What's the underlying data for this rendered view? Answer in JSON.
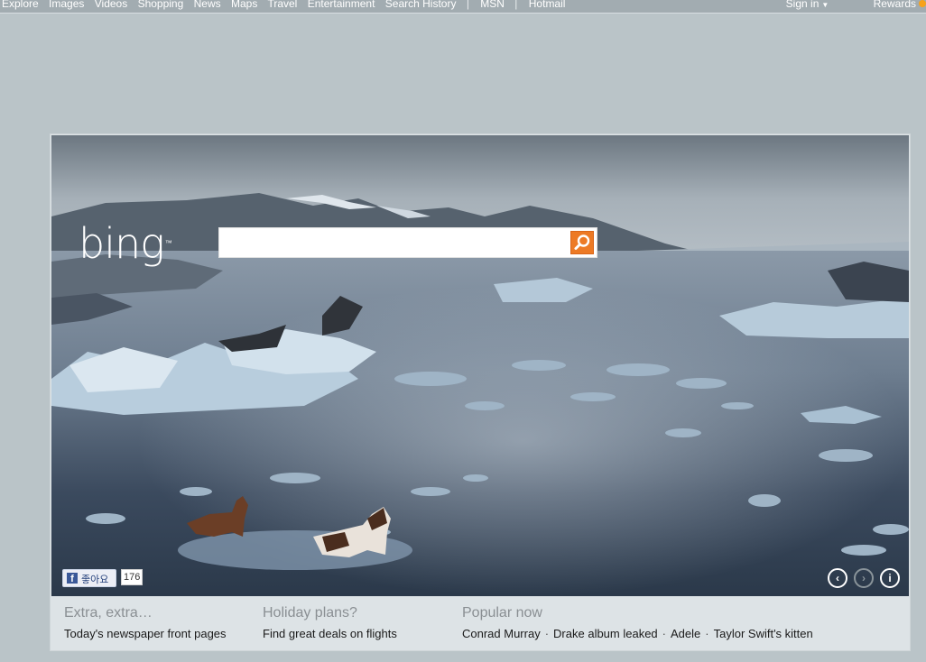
{
  "topnav": {
    "left": [
      "Explore",
      "Images",
      "Videos",
      "Shopping",
      "News",
      "Maps",
      "Travel",
      "Entertainment",
      "Search History",
      "|",
      "MSN",
      "|",
      "Hotmail"
    ],
    "sign_in": "Sign in",
    "rewards": "Rewards"
  },
  "logo": {
    "text": "bing",
    "tm": "™"
  },
  "search": {
    "value": "",
    "placeholder": ""
  },
  "like": {
    "label": "좋아요",
    "count": "176",
    "fb_letter": "f"
  },
  "hero_controls": [
    "prev-icon",
    "next-icon",
    "info-icon"
  ],
  "bottom": {
    "extra": {
      "heading": "Extra, extra…",
      "link": "Today's newspaper front pages"
    },
    "holiday": {
      "heading": "Holiday plans?",
      "link": "Find great deals on flights"
    },
    "popular": {
      "heading": "Popular now",
      "items": [
        "Conrad Murray",
        "Drake album leaked",
        "Adele",
        "Taylor Swift's kitten"
      ]
    }
  },
  "colors": {
    "accent": "#ed7a25",
    "facebook": "#3b5998"
  }
}
